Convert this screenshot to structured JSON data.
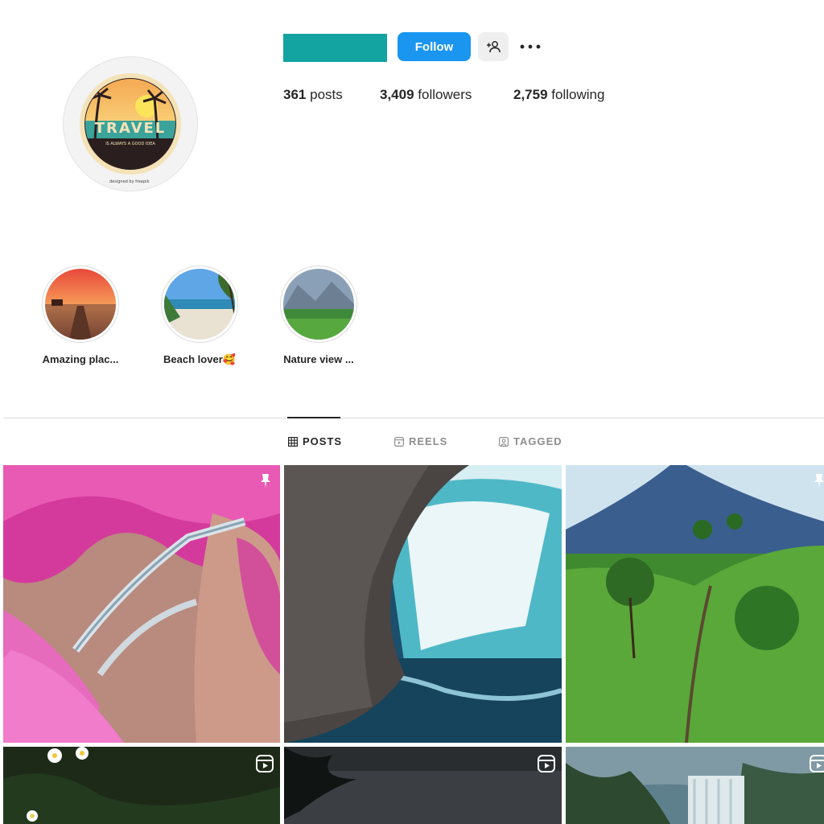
{
  "profile": {
    "avatar_logo_text": "TRAVEL",
    "avatar_logo_subtext": "IS ALWAYS A GOOD IDEA",
    "avatar_credit": "designed by freepik",
    "follow_label": "Follow",
    "brand_color": "#13a3a0",
    "accent_color": "#1a95f0"
  },
  "stats": {
    "posts_count": "361",
    "posts_label": "posts",
    "followers_count": "3,409",
    "followers_label": "followers",
    "following_count": "2,759",
    "following_label": "following"
  },
  "highlights": [
    {
      "label": "Amazing plac..."
    },
    {
      "label": "Beach lover🥰"
    },
    {
      "label": "Nature view ..."
    }
  ],
  "tabs": [
    {
      "label": "POSTS",
      "icon": "grid-icon",
      "active": true
    },
    {
      "label": "REELS",
      "icon": "reels-icon",
      "active": false
    },
    {
      "label": "TAGGED",
      "icon": "tagged-icon",
      "active": false
    }
  ],
  "grid": [
    {
      "subject": "pink flowers cliff bridge",
      "badge": "pin-icon"
    },
    {
      "subject": "waterfall rock",
      "badge": ""
    },
    {
      "subject": "green volcano hill path",
      "badge": "pin-icon"
    },
    {
      "subject": "white daisies at night",
      "badge": "reels-icon"
    },
    {
      "subject": "dark lake with leaves",
      "badge": "reels-icon"
    },
    {
      "subject": "misty forest waterfall",
      "badge": "reels-icon"
    }
  ]
}
